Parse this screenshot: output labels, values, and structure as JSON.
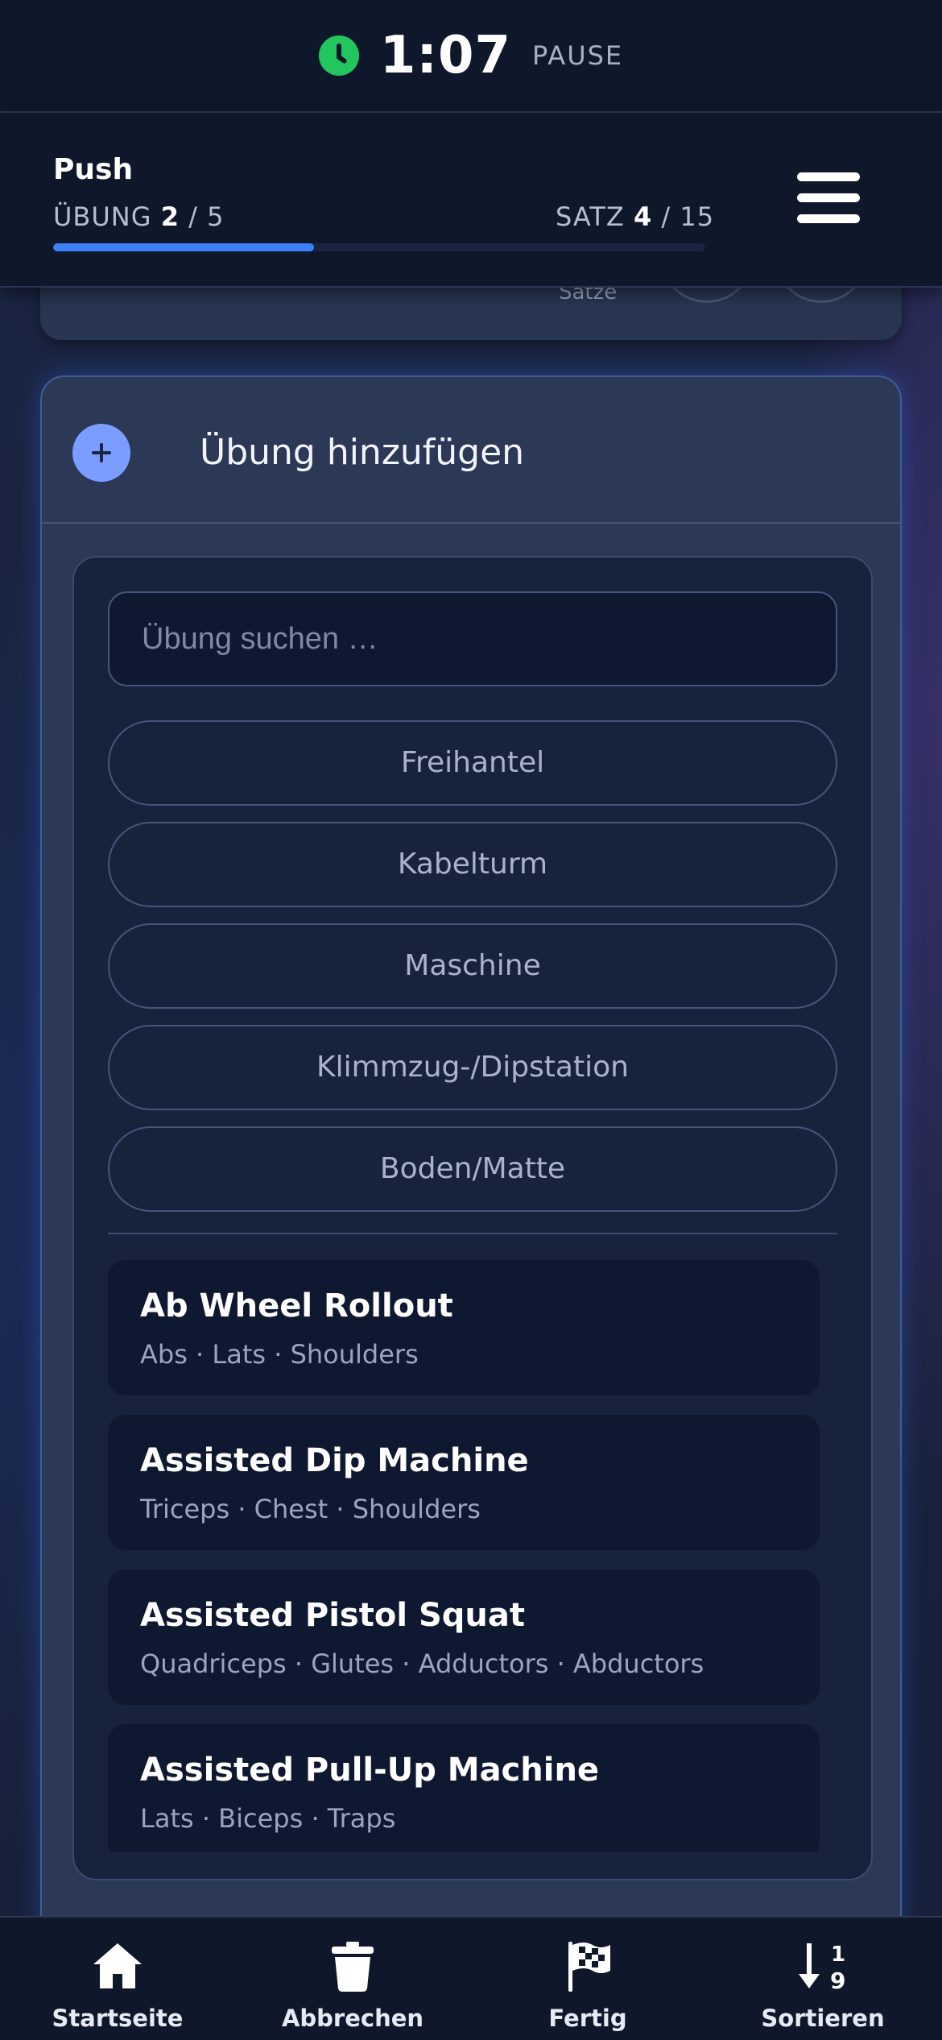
{
  "timer": {
    "value": "1:07",
    "label": "PAUSE",
    "accent_color": "#22c55e"
  },
  "header": {
    "workout_name": "Push",
    "exercise_label": "ÜBUNG",
    "exercise_current": "2",
    "exercise_total": "/ 5",
    "set_label": "SATZ",
    "set_current": "4",
    "set_total": "/ 15",
    "progress_fraction": 0.4,
    "menu_icon": "hamburger-menu-icon"
  },
  "previous_card": {
    "sets_label": "Sätze"
  },
  "add_exercise": {
    "title": "Übung hinzufügen",
    "icon": "plus-icon",
    "accent_color": "#7b9dff",
    "search_placeholder": "Übung suchen …",
    "filters": [
      "Freihantel",
      "Kabelturm",
      "Maschine",
      "Klimmzug-/Dipstation",
      "Boden/Matte"
    ],
    "exercises": [
      {
        "name": "Ab Wheel Rollout",
        "muscles": "Abs · Lats · Shoulders"
      },
      {
        "name": "Assisted Dip Machine",
        "muscles": "Triceps · Chest · Shoulders"
      },
      {
        "name": "Assisted Pistol Squat",
        "muscles": "Quadriceps · Glutes · Adductors · Abductors"
      },
      {
        "name": "Assisted Pull-Up Machine",
        "muscles": "Lats · Biceps · Traps"
      }
    ]
  },
  "bottom_nav": [
    {
      "label": "Startseite",
      "icon": "home-icon"
    },
    {
      "label": "Abbrechen",
      "icon": "trash-icon"
    },
    {
      "label": "Fertig",
      "icon": "checkered-flag-icon"
    },
    {
      "label": "Sortieren",
      "icon": "sort-numeric-icon"
    }
  ]
}
